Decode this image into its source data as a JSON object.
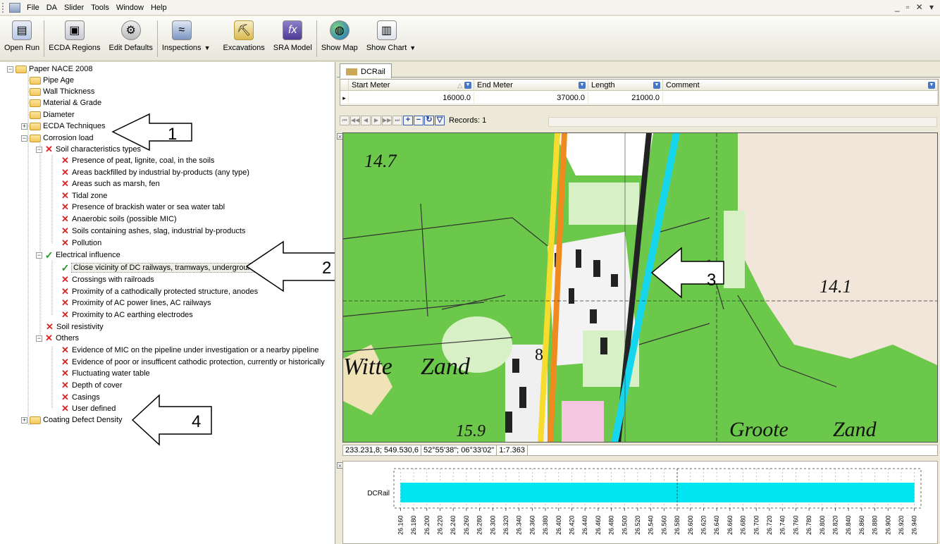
{
  "menu": {
    "items": [
      "File",
      "DA",
      "Slider",
      "Tools",
      "Window",
      "Help"
    ],
    "window_controls": "_ ▫ ✕ ▾"
  },
  "toolbar": {
    "open_run": "Open Run",
    "ecda_regions": "ECDA Regions",
    "edit_defaults": "Edit Defaults",
    "inspections": "Inspections",
    "excavations": "Excavations",
    "sra_model": "SRA Model",
    "show_map": "Show Map",
    "show_chart": "Show Chart"
  },
  "tree": {
    "root": "Paper NACE 2008",
    "pipe_age": "Pipe Age",
    "wall_thickness": "Wall Thickness",
    "material_grade": "Material & Grade",
    "diameter": "Diameter",
    "ecda_techniques": "ECDA Techniques",
    "corrosion_load": "Corrosion load",
    "soil_characteristics": "Soil characteristics types",
    "soil_items": [
      "Presence of peat, lignite, coal, in the soils",
      "Areas backfilled by industrial by-products (any type)",
      "Areas such as marsh, fen",
      "Tidal zone",
      "Presence of brackish water or sea water tabl",
      "Anaerobic soils (possible MIC)",
      "Soils containing ashes, slag, industrial by-products",
      "Pollution"
    ],
    "electrical_influence": "Electrical influence",
    "electrical_items": [
      "Close vicinity of DC railways, tramways, underground",
      "Crossings with railroads",
      "Proximity of a cathodically protected structure, anodes",
      "Proximity of AC power lines, AC railways",
      "Proximity to AC earthing electrodes"
    ],
    "soil_resistivity": "Soil resistivity",
    "others": "Others",
    "others_items": [
      "Evidence of MIC on the pipeline under investigation or a nearby pipeline",
      "Evidence of poor or insufficent cathodic protection, currently or historically",
      "Fluctuating water table",
      "Depth of cover",
      "Casings",
      "User defined"
    ],
    "coating_defect_density": "Coating Defect Density"
  },
  "annotations": {
    "a1": "1",
    "a2": "2",
    "a3": "3",
    "a4": "4"
  },
  "tab": {
    "label": "DCRail"
  },
  "grid": {
    "columns": [
      "Start Meter",
      "End Meter",
      "Length",
      "Comment"
    ],
    "sort_glyph": "△",
    "rows": [
      {
        "start": "16000.0",
        "end": "37000.0",
        "length": "21000.0",
        "comment": ""
      }
    ],
    "records_label": "Records: 1"
  },
  "map": {
    "labels": {
      "top_left": "14.7",
      "right": "14.1",
      "bottom": "15.9",
      "witte": "Witte",
      "zand": "Zand",
      "groote": "Groote",
      "zand2": "Zand",
      "eight": "8"
    }
  },
  "status": {
    "coords": "233.231,8; 549.530,6",
    "latlon": "52°55'38\"; 06°33'02\"",
    "scale": "1:7.363"
  },
  "chart_data": {
    "type": "bar",
    "series": [
      {
        "name": "DCRail",
        "start": 26.16,
        "end": 26.94
      }
    ],
    "x_ticks": [
      "26.160",
      "26.180",
      "26.200",
      "26.220",
      "26.240",
      "26.260",
      "26.280",
      "26.300",
      "26.320",
      "26.340",
      "26.360",
      "26.380",
      "26.400",
      "26.420",
      "26.440",
      "26.460",
      "26.480",
      "26.500",
      "26.520",
      "26.540",
      "26.560",
      "26.580",
      "26.600",
      "26.620",
      "26.640",
      "26.660",
      "26.680",
      "26.700",
      "26.720",
      "26.740",
      "26.760",
      "26.780",
      "26.800",
      "26.820",
      "26.840",
      "26.860",
      "26.880",
      "26.900",
      "26.920",
      "26.940"
    ],
    "xlim": [
      26.15,
      26.95
    ],
    "marker": 26.58,
    "color": "#00e5f0"
  }
}
